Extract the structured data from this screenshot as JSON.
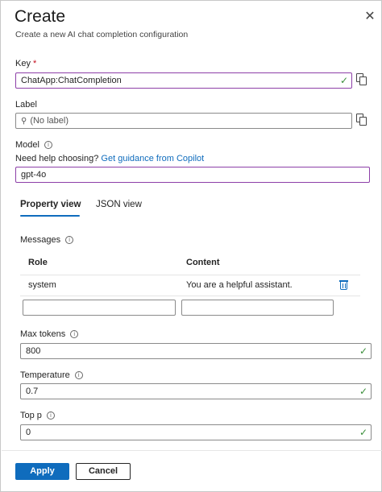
{
  "header": {
    "title": "Create",
    "subtitle": "Create a new AI chat completion configuration",
    "close_icon": "close-icon"
  },
  "key": {
    "label": "Key",
    "required_mark": "*",
    "value": "ChatApp:ChatCompletion",
    "valid": true
  },
  "label_field": {
    "label": "Label",
    "placeholder": "(No label)"
  },
  "model": {
    "label": "Model",
    "help_text": "Need help choosing?",
    "help_link": "Get guidance from Copilot",
    "value": "gpt-4o"
  },
  "tabs": [
    {
      "label": "Property view",
      "active": true
    },
    {
      "label": "JSON view",
      "active": false
    }
  ],
  "messages": {
    "label": "Messages",
    "columns": [
      "Role",
      "Content"
    ],
    "rows": [
      {
        "role": "system",
        "content": "You are a helpful assistant."
      }
    ],
    "new_row": {
      "role": "",
      "content": ""
    }
  },
  "max_tokens": {
    "label": "Max tokens",
    "value": "800"
  },
  "temperature": {
    "label": "Temperature",
    "value": "0.7"
  },
  "top_p": {
    "label": "Top p",
    "value": "0"
  },
  "footer": {
    "apply_label": "Apply",
    "cancel_label": "Cancel"
  },
  "colors": {
    "accent": "#0f6cbd",
    "focus_border": "#8d3fa8",
    "valid_check": "#3a8e3a",
    "required": "#c50f1f"
  }
}
